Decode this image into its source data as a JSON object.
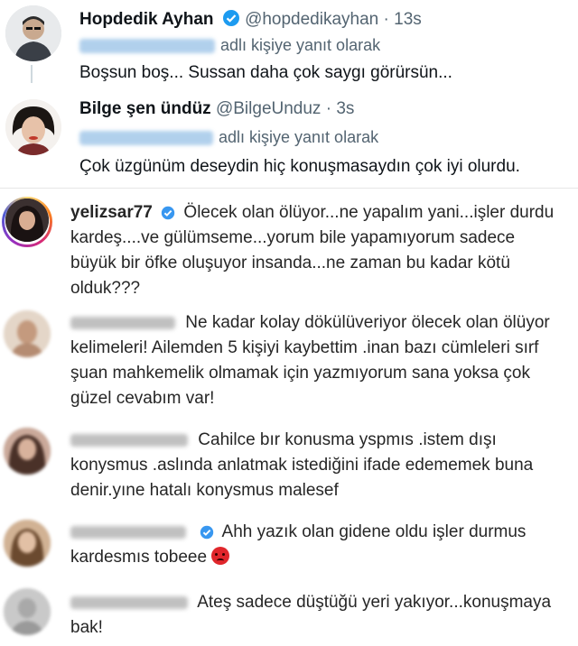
{
  "tweets": [
    {
      "name": "Hopdedik Ayhan",
      "handle": "@hopdedikayhan",
      "time": "· 13s",
      "reply_suffix": "adlı kişiye yanıt olarak",
      "text": "Boşsun boş... Sussan daha çok saygı görürsün..."
    },
    {
      "name": "Bilge şen ündüz",
      "handle": "@BilgeUnduz",
      "time": "· 3s",
      "reply_suffix": "adlı kişiye yanıt olarak",
      "text": "Çok üzgünüm deseydin hiç konuşmasaydın çok iyi olurdu."
    }
  ],
  "instagram_comments": [
    {
      "username": "yelizsar77",
      "lines": [
        "Ölecek olan ölüyor...ne yapalım yani...işler durdu",
        "kardeş....ve gülümseme...yorum bile yapamıyorum sadece",
        "büyük bir öfke oluşuyor insanda...ne zaman bu kadar kötü",
        "olduk???"
      ]
    },
    {
      "username": "",
      "lines": [
        "Ne kadar kolay dökülüveriyor ölecek olan ölüyor",
        "kelimeleri! Ailemden 5 kişiyi kaybettim .inan bazı cümleleri sırf",
        "şuan mahkemelik olmamak için yazmıyorum sana yoksa çok",
        "güzel cevabım var!"
      ]
    },
    {
      "username": "",
      "lines": [
        "Cahilce bır konusma yspmıs .istem dışı",
        "konysmus .aslında anlatmak istediğini ifade edememek buna",
        "denir.yıne hatalı konysmus malesef"
      ]
    },
    {
      "username": "",
      "lines": [
        "Ahh yazık olan gidene oldu işler durmus",
        "kardesmıs tobeee"
      ]
    },
    {
      "username": "",
      "lines": [
        "Ateş sadece düştüğü yeri yakıyor...konuşmaya",
        "bak!"
      ]
    }
  ],
  "colors": {
    "verified_blue": "#1d9bf0",
    "text_primary": "#0f1419",
    "text_secondary": "#536471",
    "ig_text": "#262626"
  }
}
